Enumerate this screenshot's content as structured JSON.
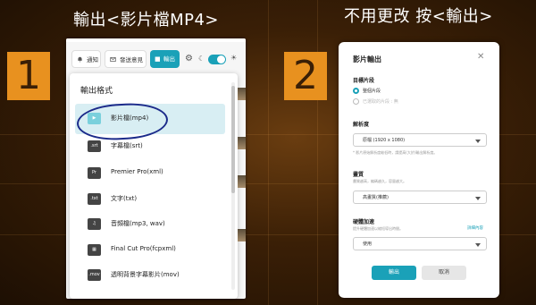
{
  "captions": {
    "left": "輸出<影片檔MP4>",
    "right": "不用更改 按<輸出>"
  },
  "steps": [
    "1",
    "2"
  ],
  "toolbar": {
    "notify": "通知",
    "feedback": "發送意見",
    "export": "輸出"
  },
  "export_menu": {
    "title": "輸出格式",
    "items": [
      {
        "icon": "▶",
        "label": "影片檔(mp4)",
        "selected": true
      },
      {
        "icon": ".srt",
        "label": "字幕檔(srt)"
      },
      {
        "icon": "Pr",
        "label": "Premier Pro(xml)"
      },
      {
        "icon": ".txt",
        "label": "文字(txt)"
      },
      {
        "icon": "♫",
        "label": "音頻檔(mp3, wav)"
      },
      {
        "icon": "▦",
        "label": "Final Cut Pro(fcpxml)"
      },
      {
        "icon": ".mov",
        "label": "透明背景字幕影片(mov)"
      }
    ]
  },
  "dialog": {
    "title": "影片輸出",
    "close": "✕",
    "target_label": "目標片段",
    "target_options": [
      {
        "label": "整個片段",
        "on": true
      },
      {
        "label": "已選取的片段 : 無",
        "on": false
      }
    ],
    "resolution_label": "解析度",
    "resolution_note": "* 影片原始解析度較低時，請提高(大於)輸出解析度。",
    "resolution_value": "原檔 (1920 x 1080)",
    "quality_label": "畫質",
    "quality_note": "畫質越高，編碼越久，容量越大。",
    "quality_value": "高畫質(推薦)",
    "hw_label": "硬體加速",
    "hw_note": "提升硬體加速以縮短導出時間。",
    "hw_link": "詳細內容",
    "hw_value": "使用",
    "ok": "輸出",
    "cancel": "取消"
  }
}
